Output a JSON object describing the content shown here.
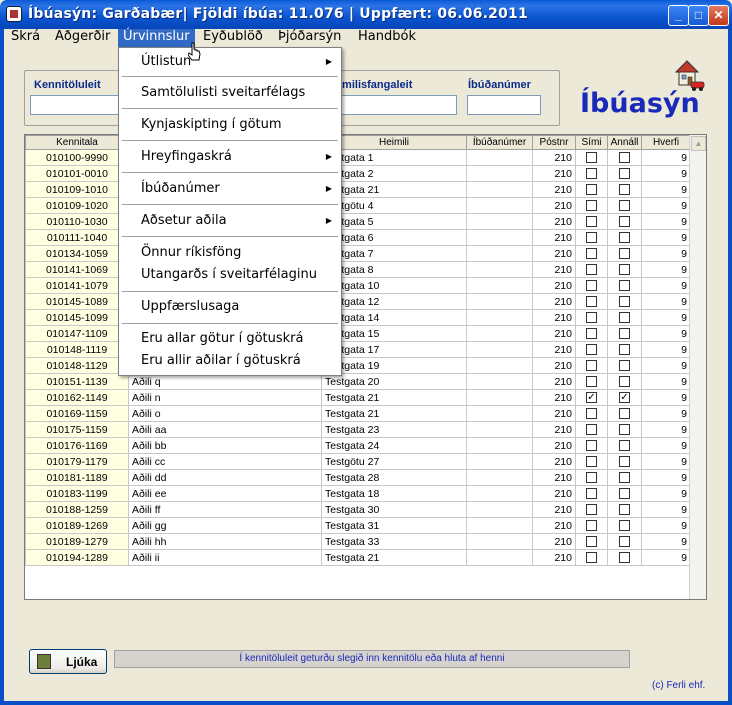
{
  "window": {
    "title": "Íbúasýn: Garðabær| Fjöldi íbúa: 11.076 | Uppfært: 06.06.2011"
  },
  "menubar": [
    "Skrá",
    "Aðgerðir",
    "Úrvinnslur",
    "Eyðublöð",
    "Þjóðarsýn",
    "Handbók"
  ],
  "dropdown": {
    "items": [
      "Útlistun",
      "Samtölulisti sveitarfélags",
      "Kynjaskipting í götum",
      "Hreyfingaskrá",
      "Íbúðanúmer",
      "Aðsetur aðila",
      "Önnur ríkisföng",
      "Utangarðs í sveitarfélaginu",
      "Uppfærslusaga",
      "Eru allar götur í götuskrá",
      "Eru allir aðilar í götuskrá"
    ]
  },
  "search": {
    "kennitala_label": "Kennitöluleit",
    "heimili_label": "imilisfangaleit",
    "ibudanumer_label": "Íbúðanúmer"
  },
  "brand": "Íbúasýn",
  "table": {
    "headers": [
      "Kennitala",
      "",
      "Heimili",
      "Íbúðanúmer",
      "Póstnr",
      "Sími",
      "Annáll",
      "Hverfi"
    ],
    "rows": [
      [
        "010100-9990",
        "",
        "Testgata 1",
        "",
        "210",
        false,
        false,
        "9"
      ],
      [
        "010101-0010",
        "",
        "Testgata 2",
        "",
        "210",
        false,
        false,
        "9"
      ],
      [
        "010109-1010",
        "",
        "Testgata 21",
        "",
        "210",
        false,
        false,
        "9"
      ],
      [
        "010109-1020",
        "",
        "Testgötu 4",
        "",
        "210",
        false,
        false,
        "9"
      ],
      [
        "010110-1030",
        "",
        "Testgata 5",
        "",
        "210",
        false,
        false,
        "9"
      ],
      [
        "010111-1040",
        "",
        "Testgata 6",
        "",
        "210",
        false,
        false,
        "9"
      ],
      [
        "010134-1059",
        "",
        "Testgata 7",
        "",
        "210",
        false,
        false,
        "9"
      ],
      [
        "010141-1069",
        "",
        "Testgata 8",
        "",
        "210",
        false,
        false,
        "9"
      ],
      [
        "010141-1079",
        "",
        "Testgata 10",
        "",
        "210",
        false,
        false,
        "9"
      ],
      [
        "010145-1089",
        "",
        "Testgata 12",
        "",
        "210",
        false,
        false,
        "9"
      ],
      [
        "010145-1099",
        "",
        "Testgata 14",
        "",
        "210",
        false,
        false,
        "9"
      ],
      [
        "010147-1109",
        "",
        "Testgata 15",
        "",
        "210",
        false,
        false,
        "9"
      ],
      [
        "010148-1119",
        "",
        "Testgata 17",
        "",
        "210",
        false,
        false,
        "9"
      ],
      [
        "010148-1129",
        "",
        "Testgata 19",
        "",
        "210",
        false,
        false,
        "9"
      ],
      [
        "010151-1139",
        "Aðili q",
        "Testgata 20",
        "",
        "210",
        false,
        false,
        "9"
      ],
      [
        "010162-1149",
        "Aðili n",
        "Testgata 21",
        "",
        "210",
        true,
        true,
        "9"
      ],
      [
        "010169-1159",
        "Aðili o",
        "Testgata 21",
        "",
        "210",
        false,
        false,
        "9"
      ],
      [
        "010175-1159",
        "Aðili aa",
        "Testgata 23",
        "",
        "210",
        false,
        false,
        "9"
      ],
      [
        "010176-1169",
        "Aðili bb",
        "Testgata 24",
        "",
        "210",
        false,
        false,
        "9"
      ],
      [
        "010179-1179",
        "Aðili cc",
        "Testgötu 27",
        "",
        "210",
        false,
        false,
        "9"
      ],
      [
        "010181-1189",
        "Aðili dd",
        "Testgata 28",
        "",
        "210",
        false,
        false,
        "9"
      ],
      [
        "010183-1199",
        "Aðili ee",
        "Testgata 18",
        "",
        "210",
        false,
        false,
        "9"
      ],
      [
        "010188-1259",
        "Aðili ff",
        "Testgata 30",
        "",
        "210",
        false,
        false,
        "9"
      ],
      [
        "010189-1269",
        "Aðili gg",
        "Testgata 31",
        "",
        "210",
        false,
        false,
        "9"
      ],
      [
        "010189-1279",
        "Aðili hh",
        "Testgata 33",
        "",
        "210",
        false,
        false,
        "9"
      ],
      [
        "010194-1289",
        "Aðili ii",
        "Testgata 21",
        "",
        "210",
        false,
        false,
        "9"
      ]
    ]
  },
  "buttons": {
    "lookup": "Ljúka"
  },
  "status": "Í kennitöluleit geturðu slegið inn kennitölu eða hluta af henni",
  "copyright": "(c) Ferli ehf."
}
